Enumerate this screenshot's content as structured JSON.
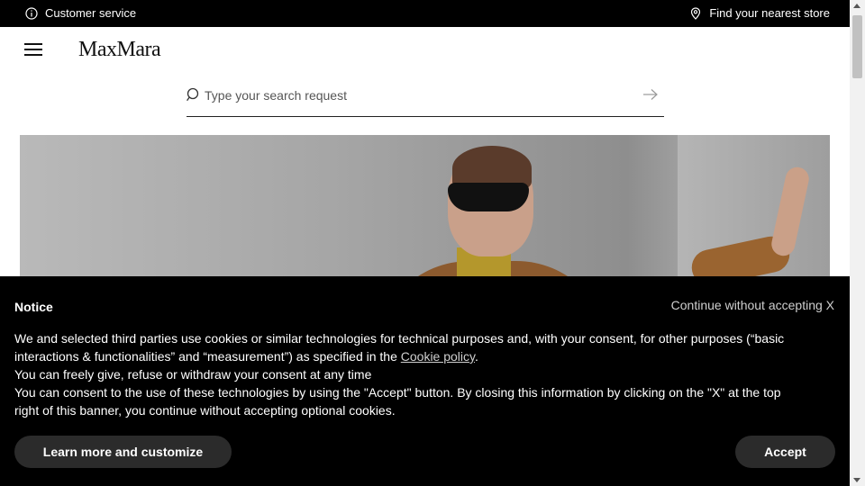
{
  "topbar": {
    "customer_service": "Customer service",
    "find_store": "Find your nearest store"
  },
  "header": {
    "logo": "MaxMara"
  },
  "search": {
    "placeholder": "Type your search request"
  },
  "cookie": {
    "title": "Notice",
    "continue_label": "Continue without accepting X",
    "line1_before": "We and selected third parties use cookies or similar technologies for technical purposes and, with your consent, for other purposes (“basic interactions & functionalities” and “measurement”) as specified in the ",
    "policy_link": "Cookie policy",
    "line1_after": ".",
    "line2": "You can freely give, refuse or withdraw your consent at any time",
    "line3": "You can consent to the use of these technologies by using the \"Accept\" button. By closing this information by clicking on the \"X\" at the top right of this banner, you continue without accepting optional cookies.",
    "learn_more_label": "Learn more and customize",
    "accept_label": "Accept"
  },
  "icons": {
    "info": "info-icon",
    "location": "location-pin-icon",
    "menu": "hamburger-menu-icon",
    "search": "search-icon",
    "submit": "arrow-right-icon"
  },
  "colors": {
    "topbar_bg": "#000000",
    "banner_bg": "#000000",
    "button_bg": "#2b2b2b"
  }
}
